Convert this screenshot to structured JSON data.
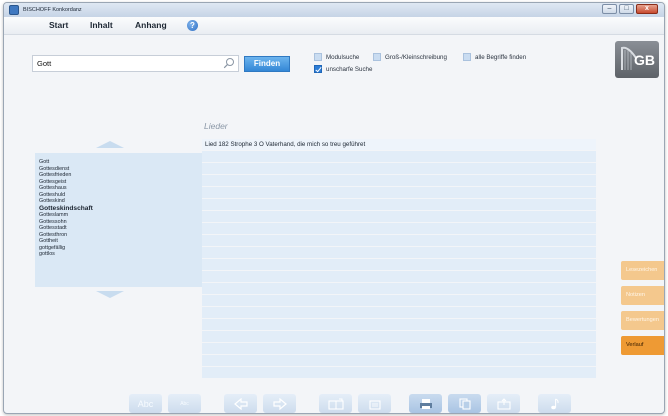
{
  "window": {
    "title": "BISCHOFF Konkordanz"
  },
  "menu": {
    "items": [
      "Start",
      "Inhalt",
      "Anhang"
    ]
  },
  "search": {
    "value": "Gott",
    "placeholder": "",
    "find_label": "Finden"
  },
  "options": [
    {
      "label": "Modulsuche",
      "checked": false
    },
    {
      "label": "Groß-/Kleinschreibung",
      "checked": false
    },
    {
      "label": "alle Begriffe finden",
      "checked": false
    },
    {
      "label": "unscharfe Suche",
      "checked": true
    }
  ],
  "logo": {
    "text": "GB"
  },
  "wordlist": {
    "items": [
      {
        "text": "Gott",
        "bold": false
      },
      {
        "text": "Gottesdienst",
        "bold": false
      },
      {
        "text": "Gottesfrieden",
        "bold": false
      },
      {
        "text": "Gottesgeist",
        "bold": false
      },
      {
        "text": "Gotteshaus",
        "bold": false
      },
      {
        "text": "Gotteshuld",
        "bold": false
      },
      {
        "text": "Gotteskind",
        "bold": false
      },
      {
        "text": "Gotteskindschaft",
        "bold": true
      },
      {
        "text": "Gotteslamm",
        "bold": false
      },
      {
        "text": "Gottessohn",
        "bold": false
      },
      {
        "text": "Gottesstadt",
        "bold": false
      },
      {
        "text": "Gottesthron",
        "bold": false
      },
      {
        "text": "Gottheit",
        "bold": false
      },
      {
        "text": "gottgefällig",
        "bold": false
      },
      {
        "text": "gottlos",
        "bold": false
      }
    ]
  },
  "results": {
    "title": "Lieder",
    "rows": [
      "Lied 182 Strophe 3 O Vaterhand, die mich so treu geführet"
    ],
    "empty_rows": 19
  },
  "side_tabs": [
    {
      "label": "Lesezeichen",
      "active": false
    },
    {
      "label": "Notizen",
      "active": false
    },
    {
      "label": "Bewertungen",
      "active": false
    },
    {
      "label": "Verlauf",
      "active": true
    }
  ],
  "toolbar": {
    "font_large_label": "Abc",
    "font_small_label": "Abc"
  },
  "colors": {
    "accent": "#3487d6",
    "tab_active": "#ee9a34",
    "tab_pale": "#f4c88d",
    "list_bg": "#dae8f5"
  }
}
